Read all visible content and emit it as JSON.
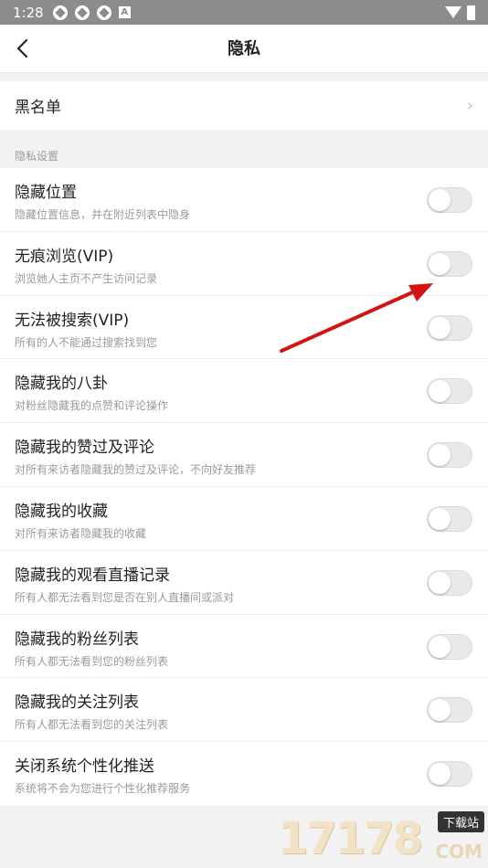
{
  "status_bar": {
    "time": "1:28",
    "sb_letter": "A"
  },
  "header": {
    "title": "隐私"
  },
  "blacklist": {
    "label": "黑名单"
  },
  "section": {
    "title": "隐私设置"
  },
  "settings": [
    {
      "title": "隐藏位置",
      "desc": "隐藏位置信息，并在附近列表中隐身",
      "enabled": false
    },
    {
      "title": "无痕浏览(VIP)",
      "desc": "浏览她人主页不产生访问记录",
      "enabled": false
    },
    {
      "title": "无法被搜索(VIP)",
      "desc": "所有的人不能通过搜索找到您",
      "enabled": false
    },
    {
      "title": "隐藏我的八卦",
      "desc": "对粉丝隐藏我的点赞和评论操作",
      "enabled": false
    },
    {
      "title": "隐藏我的赞过及评论",
      "desc": "对所有来访者隐藏我的赞过及评论，不向好友推荐",
      "enabled": false
    },
    {
      "title": "隐藏我的收藏",
      "desc": "对所有来访者隐藏我的收藏",
      "enabled": false
    },
    {
      "title": "隐藏我的观看直播记录",
      "desc": "所有人都无法看到您是否在别人直播间或派对",
      "enabled": false
    },
    {
      "title": "隐藏我的粉丝列表",
      "desc": "所有人都无法看到您的粉丝列表",
      "enabled": false
    },
    {
      "title": "隐藏我的关注列表",
      "desc": "所有人都无法看到您的关注列表",
      "enabled": false
    },
    {
      "title": "关闭系统个性化推送",
      "desc": "系统将不会为您进行个性化推荐服务",
      "enabled": false
    }
  ],
  "watermark": {
    "digits": "17178",
    "tag": "下载站",
    "domain": "COM"
  },
  "colors": {
    "annotation_arrow": "#d21414",
    "toggle_off": "#e9e9e9"
  }
}
